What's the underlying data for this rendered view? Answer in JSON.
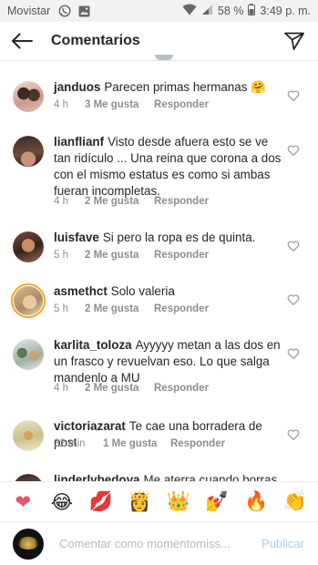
{
  "status_bar": {
    "carrier": "Movistar",
    "battery": "58 %",
    "time": "3:49 p. m."
  },
  "header": {
    "title": "Comentarios"
  },
  "comments": [
    {
      "user": "janduos",
      "text": "Parecen primas hermanas 🤗",
      "time": "4 h",
      "likes": "3 Me gusta",
      "reply": "Responder"
    },
    {
      "user": "lianflianf",
      "text": "Visto desde afuera esto se ve tan ridículo ... Una reina que corona a dos con el mismo estatus es como si ambas fueran incompletas.",
      "time": "4 h",
      "likes": "2 Me gusta",
      "reply": "Responder"
    },
    {
      "user": "luisfave",
      "text": "Si pero la ropa es de quinta.",
      "time": "5 h",
      "likes": "2 Me gusta",
      "reply": "Responder"
    },
    {
      "user": "asmethct",
      "text": "Solo valeria",
      "time": "5 h",
      "likes": "2 Me gusta",
      "reply": "Responder"
    },
    {
      "user": "karlita_toloza",
      "text": "Ayyyyy metan a las dos en un frasco y revuelvan eso. Lo que salga mandenlo a MU",
      "time": "4 h",
      "likes": "2 Me gusta",
      "reply": "Responder"
    },
    {
      "user": "victoriazarat",
      "text": "Te cae una borradera de post",
      "time": "32 min",
      "likes": "1 Me gusta",
      "reply": "Responder"
    },
    {
      "user": "linderlybedoya",
      "text": "Me aterra cuando borras",
      "time": "",
      "likes": "",
      "reply": ""
    }
  ],
  "reactions": [
    "❤",
    "😂",
    "💋",
    "👸",
    "👑",
    "💅",
    "🔥",
    "👏"
  ],
  "composer": {
    "placeholder": "Comentar como momentomiss...",
    "post_label": "Publicar"
  },
  "colors": {
    "accent": "#3897f0",
    "post_disabled": "#a8cdf2",
    "muted": "#8e8e8e",
    "text": "#262626"
  }
}
